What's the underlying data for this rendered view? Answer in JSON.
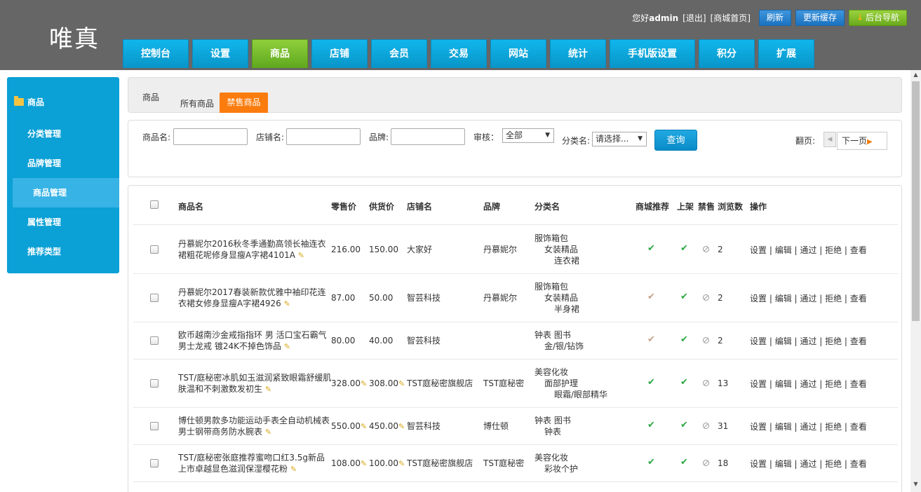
{
  "logo": "唯真",
  "topbar": {
    "greeting": "您好",
    "user": "admin",
    "logout": "[退出]",
    "home": "[商城首页]",
    "refresh": "刷新",
    "cache": "更新缓存",
    "backend": "后台导航"
  },
  "nav": [
    "控制台",
    "设置",
    "商品",
    "店铺",
    "会员",
    "交易",
    "网站",
    "统计",
    "手机版设置",
    "积分",
    "扩展"
  ],
  "sidebar": {
    "title": "商品",
    "items": [
      "分类管理",
      "品牌管理",
      "商品管理",
      "属性管理",
      "推荐类型"
    ]
  },
  "crumb": {
    "label": "商品",
    "tab_all": "所有商品",
    "tab_ban": "禁售商品"
  },
  "filter": {
    "name_label": "商品名:",
    "shop_label": "店铺名:",
    "brand_label": "品牌:",
    "audit_label": "审核：",
    "audit_value": "全部",
    "cat_label": "分类名:",
    "cat_value": "请选择...",
    "search": "查询",
    "page_label": "翻页:",
    "next": "下一页"
  },
  "table": {
    "headers": [
      "商品名",
      "零售价",
      "供货价",
      "店铺名",
      "品牌",
      "分类名",
      "商城推荐",
      "上架",
      "禁售",
      "浏览数",
      "操作"
    ],
    "rows": [
      {
        "name1": "丹慕妮尔2016秋冬季通勤高领长袖连衣",
        "name2": "裙粗花呢修身显瘦A字裙4101A",
        "price": "216.00",
        "supply": "150.00",
        "shop": "大家好",
        "brand": "丹慕妮尔",
        "cat1": "服饰箱包",
        "cat2": "女装精品",
        "cat3": "连衣裙",
        "views": "2"
      },
      {
        "name1": "丹慕妮尔2017春装新款优雅中袖印花连",
        "name2": "衣裙女修身显瘦A字裙4926",
        "price": "87.00",
        "supply": "50.00",
        "shop": "智芸科技",
        "brand": "丹慕妮尔",
        "cat1": "服饰箱包",
        "cat2": "女装精品",
        "cat3": "半身裙",
        "views": "2"
      },
      {
        "name1": "欧币越南沙金戒指指环 男 活口宝石霸气",
        "name2": "男士龙戒 镀24K不掉色饰品",
        "price": "80.00",
        "supply": "40.00",
        "shop": "智芸科技",
        "brand": "",
        "cat1": "钟表 图书",
        "cat2": "金/银/钻饰",
        "cat3": "",
        "views": "2"
      },
      {
        "name1": "TST/庭秘密冰肌如玉滋润紧致眼霜舒缓肌",
        "name2": "肤温和不刺激数发初生",
        "price": "328.00",
        "supply": "308.00",
        "shop": "TST庭秘密旗舰店",
        "brand": "TST庭秘密",
        "cat1": "美容化妆",
        "cat2": "面部护理",
        "cat3": "眼霜/眼部精华",
        "views": "13"
      },
      {
        "name1": "博仕顿男款多功能运动手表全自动机械表",
        "name2": "男士钢带商务防水腕表",
        "price": "550.00",
        "supply": "450.00",
        "shop": "智芸科技",
        "brand": "博仕顿",
        "cat1": "钟表 图书",
        "cat2": "钟表",
        "cat3": "",
        "views": "31"
      },
      {
        "name1": "TST/庭秘密张庭推荐蜜吻口红3.5g新品",
        "name2": "上市卓越显色滋润保湿樱花粉",
        "price": "108.00",
        "supply": "100.00",
        "shop": "TST庭秘密旗舰店",
        "brand": "TST庭秘密",
        "cat1": "美容化妆",
        "cat2": "彩妆个护",
        "cat3": "",
        "views": "18"
      }
    ],
    "ops": [
      "设置",
      "编辑",
      "通过",
      "拒绝",
      "查看"
    ]
  }
}
